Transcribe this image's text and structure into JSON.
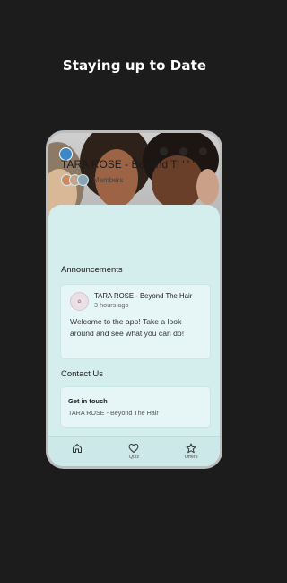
{
  "headline": "Staying up to Date",
  "app": {
    "title": "TARA ROSE - Beyond T' ' ' '",
    "members_label": "Members"
  },
  "announcements": {
    "heading": "Announcements",
    "author": "TARA ROSE - Beyond The Hair",
    "time": "3 hours ago",
    "message": "Welcome to the app! Take a look around and see what you can do!"
  },
  "contact": {
    "heading": "Contact Us",
    "title": "Get in touch",
    "subtitle": "TARA ROSE - Beyond The Hair"
  },
  "tabs": [
    {
      "icon": "home-icon",
      "label": ""
    },
    {
      "icon": "heart-icon",
      "label": "Quiz"
    },
    {
      "icon": "star-icon",
      "label": "Offers"
    }
  ],
  "colors": {
    "background": "#1c1c1c",
    "screen": "#d4eeee",
    "accent": "#3a88c9"
  }
}
